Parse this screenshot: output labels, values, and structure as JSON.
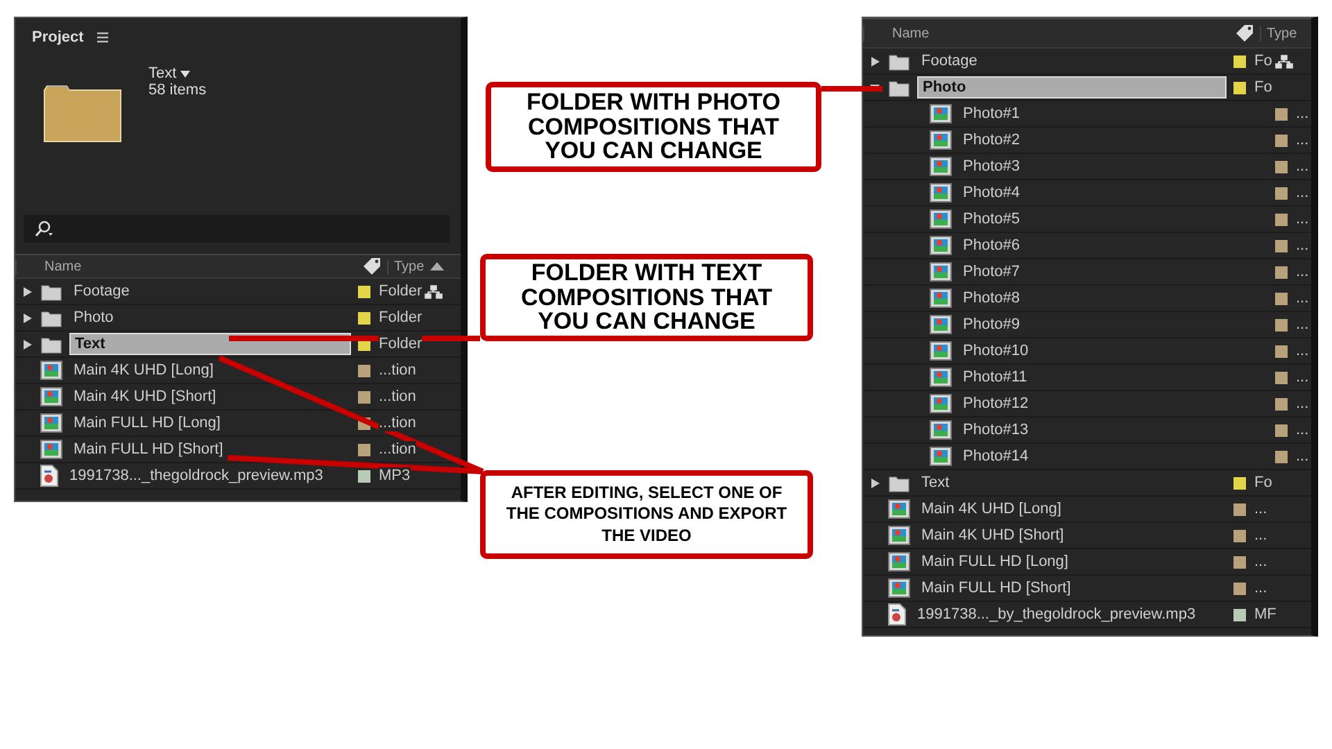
{
  "left_panel": {
    "title": "Project",
    "folder_name": "Text",
    "item_count": "58 items",
    "columns": [
      "Name",
      "Type"
    ],
    "items": [
      {
        "kind": "folder",
        "name": "Footage",
        "type": "Folder",
        "color": "#e3d54a",
        "expanded": false,
        "selected": false,
        "flow": true
      },
      {
        "kind": "folder",
        "name": "Photo",
        "type": "Folder",
        "color": "#e3d54a",
        "expanded": false,
        "selected": false
      },
      {
        "kind": "folder",
        "name": "Text",
        "type": "Folder",
        "color": "#e3d54a",
        "expanded": false,
        "selected": true
      },
      {
        "kind": "comp",
        "name": "Main 4K UHD [Long]",
        "type": "...tion",
        "color": "#b7a27c"
      },
      {
        "kind": "comp",
        "name": "Main 4K UHD [Short]",
        "type": "...tion",
        "color": "#b7a27c"
      },
      {
        "kind": "comp",
        "name": "Main FULL HD [Long]",
        "type": "...tion",
        "color": "#b7a27c"
      },
      {
        "kind": "comp",
        "name": "Main FULL HD [Short]",
        "type": "...tion",
        "color": "#b7a27c"
      },
      {
        "kind": "audio",
        "name": "1991738..._thegoldrock_preview.mp3",
        "type": "MP3",
        "color": "#b9cab7"
      }
    ]
  },
  "right_panel": {
    "columns": [
      "Name",
      "Type"
    ],
    "items": [
      {
        "kind": "folder",
        "name": "Footage",
        "type": "Fo",
        "color": "#e3d54a",
        "expanded": false,
        "selected": false,
        "flow": true
      },
      {
        "kind": "folder",
        "name": "Photo",
        "type": "Fo",
        "color": "#e3d54a",
        "expanded": true,
        "selected": true,
        "children": [
          {
            "kind": "comp",
            "name": "Photo#1",
            "type": "...",
            "color": "#b7a27c"
          },
          {
            "kind": "comp",
            "name": "Photo#2",
            "type": "...",
            "color": "#b7a27c"
          },
          {
            "kind": "comp",
            "name": "Photo#3",
            "type": "...",
            "color": "#b7a27c"
          },
          {
            "kind": "comp",
            "name": "Photo#4",
            "type": "...",
            "color": "#b7a27c"
          },
          {
            "kind": "comp",
            "name": "Photo#5",
            "type": "...",
            "color": "#b7a27c"
          },
          {
            "kind": "comp",
            "name": "Photo#6",
            "type": "...",
            "color": "#b7a27c"
          },
          {
            "kind": "comp",
            "name": "Photo#7",
            "type": "...",
            "color": "#b7a27c"
          },
          {
            "kind": "comp",
            "name": "Photo#8",
            "type": "...",
            "color": "#b7a27c"
          },
          {
            "kind": "comp",
            "name": "Photo#9",
            "type": "...",
            "color": "#b7a27c"
          },
          {
            "kind": "comp",
            "name": "Photo#10",
            "type": "...",
            "color": "#b7a27c"
          },
          {
            "kind": "comp",
            "name": "Photo#11",
            "type": "...",
            "color": "#b7a27c"
          },
          {
            "kind": "comp",
            "name": "Photo#12",
            "type": "...",
            "color": "#b7a27c"
          },
          {
            "kind": "comp",
            "name": "Photo#13",
            "type": "...",
            "color": "#b7a27c"
          },
          {
            "kind": "comp",
            "name": "Photo#14",
            "type": "...",
            "color": "#b7a27c"
          }
        ]
      },
      {
        "kind": "folder",
        "name": "Text",
        "type": "Fo",
        "color": "#e3d54a",
        "expanded": false,
        "selected": false
      },
      {
        "kind": "comp",
        "name": "Main 4K UHD [Long]",
        "type": "...",
        "color": "#b7a27c"
      },
      {
        "kind": "comp",
        "name": "Main 4K UHD [Short]",
        "type": "...",
        "color": "#b7a27c"
      },
      {
        "kind": "comp",
        "name": "Main FULL HD [Long]",
        "type": "...",
        "color": "#b7a27c"
      },
      {
        "kind": "comp",
        "name": "Main FULL HD [Short]",
        "type": "...",
        "color": "#b7a27c"
      },
      {
        "kind": "audio",
        "name": "1991738..._by_thegoldrock_preview.mp3",
        "type": "MF",
        "color": "#b9cab7"
      }
    ]
  },
  "callouts": [
    {
      "text": "FOLDER WITH PHOTO COMPOSITIONS THAT YOU CAN CHANGE",
      "kind": "heading"
    },
    {
      "text": "FOLDER WITH TEXT COMPOSITIONS THAT YOU CAN CHANGE",
      "kind": "heading"
    },
    {
      "text": "AFTER EDITING, SELECT ONE OF THE COMPOSITIONS AND EXPORT THE VIDEO",
      "kind": "note"
    }
  ]
}
